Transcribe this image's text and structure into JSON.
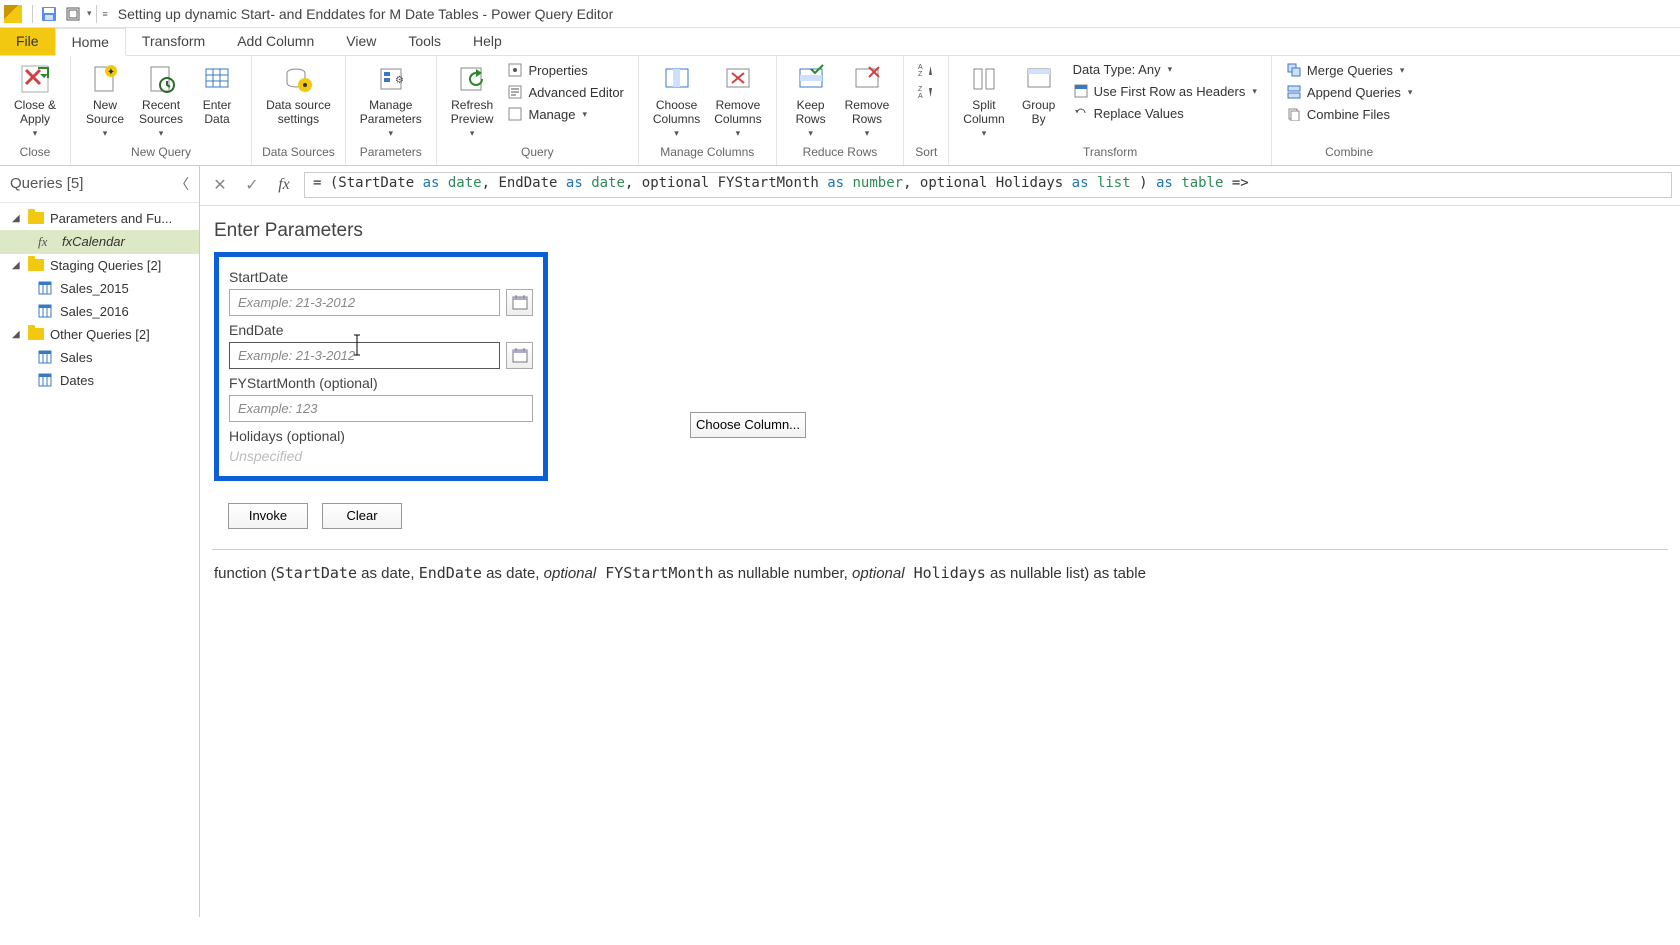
{
  "titlebar": {
    "title": "Setting up dynamic Start- and Enddates for M Date Tables - Power Query Editor"
  },
  "tabs": {
    "file": "File",
    "home": "Home",
    "transform": "Transform",
    "add_column": "Add Column",
    "view": "View",
    "tools": "Tools",
    "help": "Help"
  },
  "ribbon": {
    "close": {
      "label": "Close &\nApply",
      "group": "Close"
    },
    "new_query": {
      "new_source": "New\nSource",
      "recent_sources": "Recent\nSources",
      "enter_data": "Enter\nData",
      "group": "New Query"
    },
    "data_sources": {
      "settings": "Data source\nsettings",
      "group": "Data Sources"
    },
    "parameters": {
      "manage": "Manage\nParameters",
      "group": "Parameters"
    },
    "query": {
      "refresh": "Refresh\nPreview",
      "properties": "Properties",
      "advanced_editor": "Advanced Editor",
      "manage": "Manage",
      "group": "Query"
    },
    "manage_columns": {
      "choose": "Choose\nColumns",
      "remove": "Remove\nColumns",
      "group": "Manage Columns"
    },
    "reduce_rows": {
      "keep": "Keep\nRows",
      "remove": "Remove\nRows",
      "group": "Reduce Rows"
    },
    "sort": {
      "group": "Sort"
    },
    "transform": {
      "split": "Split\nColumn",
      "group_by": "Group\nBy",
      "data_type": "Data Type: Any",
      "first_row": "Use First Row as Headers",
      "replace": "Replace Values",
      "group": "Transform"
    },
    "combine": {
      "merge": "Merge Queries",
      "append": "Append Queries",
      "combine_files": "Combine Files",
      "group": "Combine"
    }
  },
  "queries_pane": {
    "header": "Queries [5]",
    "groups": [
      {
        "label": "Parameters and Fu...",
        "items": [
          {
            "name": "fxCalendar",
            "type": "fx",
            "selected": true
          }
        ]
      },
      {
        "label": "Staging Queries [2]",
        "items": [
          {
            "name": "Sales_2015",
            "type": "table"
          },
          {
            "name": "Sales_2016",
            "type": "table"
          }
        ]
      },
      {
        "label": "Other Queries [2]",
        "items": [
          {
            "name": "Sales",
            "type": "table"
          },
          {
            "name": "Dates",
            "type": "table"
          }
        ]
      }
    ]
  },
  "formula": {
    "raw_prefix": "= (StartDate ",
    "as": "as",
    "date": "date",
    "number": "number",
    "list": "list",
    "table": "table",
    "text_parts": {
      "p1": "= (StartDate ",
      "p2": ", EndDate ",
      "p3": ", optional FYStartMonth ",
      "p4": ", optional Holidays ",
      "p5": " ) ",
      "p6": " =>"
    }
  },
  "params": {
    "title": "Enter Parameters",
    "start_label": "StartDate",
    "start_placeholder": "Example: 21-3-2012",
    "end_label": "EndDate",
    "end_placeholder": "Example: 21-3-2012",
    "fy_label": "FYStartMonth (optional)",
    "fy_placeholder": "Example: 123",
    "holidays_label": "Holidays (optional)",
    "holidays_value": "Unspecified",
    "choose_column": "Choose Column...",
    "invoke": "Invoke",
    "clear": "Clear"
  },
  "signature": {
    "prefix": "function (",
    "p1": "StartDate",
    "p2": " as date, ",
    "p3": "EndDate",
    "p4": " as date, ",
    "p5": "optional",
    "p6": " FYStartMonth",
    "p7": " as nullable number, ",
    "p8": "optional",
    "p9": " Holidays",
    "p10": " as nullable list) as table"
  }
}
